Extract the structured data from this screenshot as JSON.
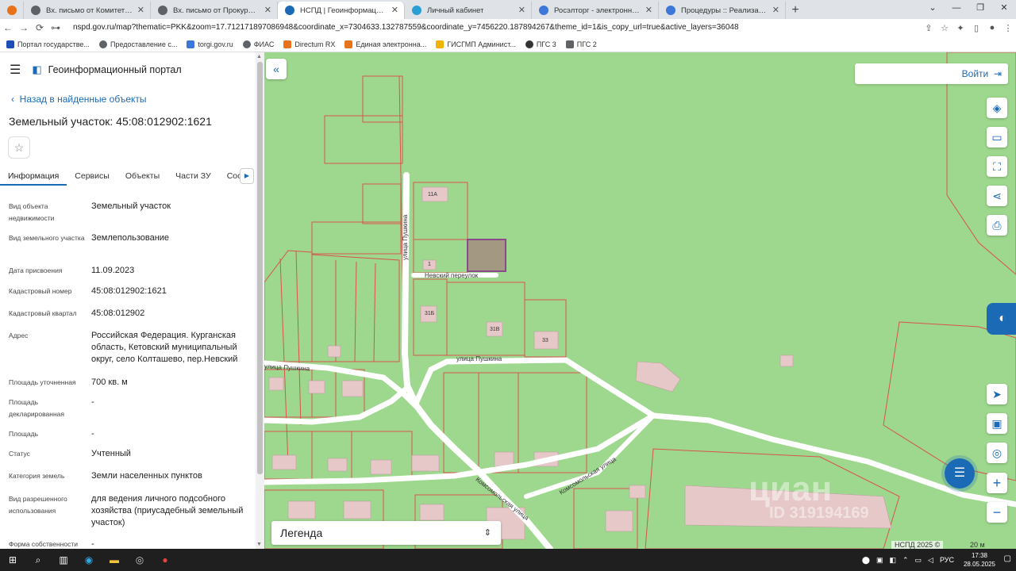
{
  "browser": {
    "tabs": [
      {
        "label": "Вх. письмо от Комитет по упра"
      },
      {
        "label": "Вх. письмо от Прокуратура Кет"
      },
      {
        "label": "НСПД | Геоинформационный п"
      },
      {
        "label": "Личный кабинет"
      },
      {
        "label": "Росэлторг - электронная торгов"
      },
      {
        "label": "Процедуры :: Реализация госим"
      }
    ],
    "url": "nspd.gov.ru/map?thematic=PKK&zoom=17.712171897086948&coordinate_x=7304633.132787559&coordinate_y=7456220.187894267&theme_id=1&is_copy_url=true&active_layers=36048",
    "bookmarks": [
      {
        "label": "Портал государстве..."
      },
      {
        "label": "Предоставление с..."
      },
      {
        "label": "torgi.gov.ru"
      },
      {
        "label": "ФИАС"
      },
      {
        "label": "Directum RX"
      },
      {
        "label": "Единая электронна..."
      },
      {
        "label": "ГИСГМП Админист..."
      },
      {
        "label": "ПГС 3"
      },
      {
        "label": "ПГС 2"
      }
    ]
  },
  "app": {
    "title": "Геоинформационный портал",
    "back_label": "Назад в найденные объекты",
    "object_title": "Земельный участок: 45:08:012902:1621",
    "tabs": [
      {
        "label": "Информация"
      },
      {
        "label": "Сервисы"
      },
      {
        "label": "Объекты"
      },
      {
        "label": "Части ЗУ"
      },
      {
        "label": "Соста"
      }
    ],
    "properties": [
      {
        "label": "Вид объекта недвижимости",
        "value": "Земельный участок"
      },
      {
        "label": "Вид земельного участка",
        "value": "Землепользование"
      },
      {
        "label": "Дата присвоения",
        "value": "11.09.2023"
      },
      {
        "label": "Кадастровый номер",
        "value": "45:08:012902:1621"
      },
      {
        "label": "Кадастровый квартал",
        "value": "45:08:012902"
      },
      {
        "label": "Адрес",
        "value": "Российская Федерация. Курганская область, Кетовский муниципальный округ, село Колташево, пер.Невский"
      },
      {
        "label": "Площадь уточненная",
        "value": "700 кв. м"
      },
      {
        "label": "Площадь декларированная",
        "value": "-"
      },
      {
        "label": "Площадь",
        "value": "-"
      },
      {
        "label": "Статус",
        "value": "Учтенный"
      },
      {
        "label": "Категория земель",
        "value": "Земли населенных пунктов"
      },
      {
        "label": "Вид разрешенного использования",
        "value": "для ведения личного подсобного хозяйства (приусадебный земельный участок)"
      },
      {
        "label": "Форма собственности",
        "value": "-"
      }
    ]
  },
  "map": {
    "login_label": "Войти",
    "legend_label": "Легенда",
    "attribution": "НСПД 2025 ©",
    "scale": "20 м",
    "watermark": "циан",
    "watermark_id": "ID 319194169",
    "streets": [
      {
        "label": "улица Пушкина"
      },
      {
        "label": "Невский переулок"
      },
      {
        "label": "улица Пушкина"
      },
      {
        "label": "улица Пушкина"
      },
      {
        "label": "Комсомольская улица"
      },
      {
        "label": "Комсомольская улица"
      }
    ],
    "colors": {
      "map_bg": "#9ed88e",
      "parcel_line": "#d9534f",
      "highlight": "#8b4a8b",
      "accent": "#1b6ab6"
    }
  },
  "taskbar": {
    "lang": "РУС",
    "time": "17:38",
    "date": "28.05.2025"
  }
}
